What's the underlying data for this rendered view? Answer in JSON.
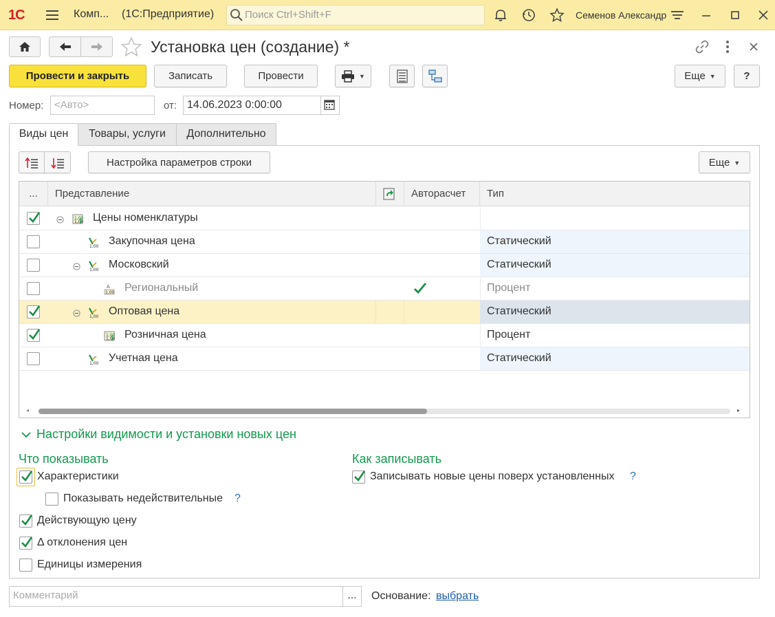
{
  "titlebar": {
    "logo": "1С",
    "app_short": "Комп...",
    "platform": "(1С:Предприятие)",
    "search_placeholder": "Поиск Ctrl+Shift+F",
    "user": "Семенов Александр"
  },
  "header": {
    "title": "Установка цен (создание) *"
  },
  "toolbar": {
    "post_close": "Провести и закрыть",
    "save": "Записать",
    "post": "Провести",
    "more": "Еще",
    "help": "?"
  },
  "fields": {
    "number_label": "Номер:",
    "number_placeholder": "<Авто>",
    "date_label": "от:",
    "date_value": "14.06.2023  0:00:00"
  },
  "tabs": [
    {
      "label": "Виды цен",
      "active": true
    },
    {
      "label": "Товары, услуги",
      "active": false
    },
    {
      "label": "Дополнительно",
      "active": false
    }
  ],
  "panel_toolbar": {
    "row_settings": "Настройка параметров строки",
    "more": "Еще"
  },
  "table": {
    "columns": {
      "check": "...",
      "name": "Представление",
      "autocalc": "Авторасчет",
      "type": "Тип"
    },
    "rows": [
      {
        "checked": true,
        "name": "Цены номенклатуры",
        "type": "",
        "auto": false,
        "muted": false
      },
      {
        "checked": false,
        "name": "Закупочная цена",
        "type": "Статический",
        "auto": false,
        "muted": false
      },
      {
        "checked": false,
        "name": "Московский",
        "type": "Статический",
        "auto": false,
        "muted": false
      },
      {
        "checked": false,
        "name": "Региональный",
        "type": "Процент",
        "auto": true,
        "muted": true
      },
      {
        "checked": true,
        "name": "Оптовая цена",
        "type": "Статический",
        "auto": false,
        "muted": false
      },
      {
        "checked": true,
        "name": "Розничная цена",
        "type": "Процент",
        "auto": false,
        "muted": false
      },
      {
        "checked": false,
        "name": "Учетная цена",
        "type": "Статический",
        "auto": false,
        "muted": false
      }
    ]
  },
  "visibility": {
    "group_title": "Настройки видимости и установки новых цен",
    "show_title": "Что показывать",
    "write_title": "Как записывать",
    "options": [
      {
        "label": "Характеристики",
        "checked": true
      },
      {
        "label": "Показывать недействительные",
        "checked": false
      },
      {
        "label": "Действующую цену",
        "checked": true
      },
      {
        "label": "Δ отклонения цен",
        "checked": true
      },
      {
        "label": "Единицы измерения",
        "checked": false
      }
    ],
    "write_option": {
      "label": "Записывать новые цены поверх установленных",
      "checked": true
    },
    "help": "?"
  },
  "footer": {
    "comment_placeholder": "Комментарий",
    "ellipsis": "...",
    "basis_label": "Основание:",
    "basis_link": "выбрать"
  },
  "colors": {
    "titlebar": "#fbeca5",
    "primary_button": "#f9e13b",
    "accent_green": "#119a4b",
    "selected_row": "#fcf2c6"
  }
}
